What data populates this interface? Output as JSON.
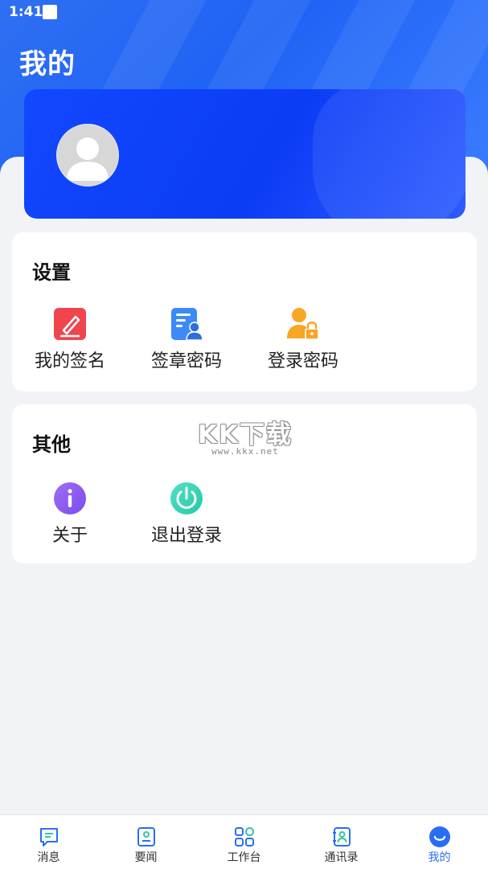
{
  "status_bar": {
    "time": "1:41"
  },
  "header": {
    "title": "我的"
  },
  "settings": {
    "title": "设置",
    "items": [
      {
        "label": "我的签名",
        "icon": "signature-pen-icon",
        "color": "#f0454f"
      },
      {
        "label": "签章密码",
        "icon": "seal-document-icon",
        "color": "#3d8af7"
      },
      {
        "label": "登录密码",
        "icon": "user-lock-icon",
        "color": "#f8a626"
      }
    ]
  },
  "other": {
    "title": "其他",
    "items": [
      {
        "label": "关于",
        "icon": "info-icon",
        "color": "#8a5cf0"
      },
      {
        "label": "退出登录",
        "icon": "power-icon",
        "color": "#2fd5b4"
      }
    ]
  },
  "overlay_logo": {
    "text": "KK下载",
    "url": "www.kkx.net"
  },
  "tabbar": {
    "items": [
      {
        "label": "消息",
        "icon": "message-icon"
      },
      {
        "label": "要闻",
        "icon": "news-icon"
      },
      {
        "label": "工作台",
        "icon": "workbench-icon"
      },
      {
        "label": "通讯录",
        "icon": "contacts-icon"
      },
      {
        "label": "我的",
        "icon": "profile-icon",
        "active": true
      }
    ],
    "active_color": "#2a6df5"
  },
  "colors": {
    "header_blue": "#1f63f5",
    "card_blue": "#0b3cf6",
    "background": "#f2f3f7"
  }
}
